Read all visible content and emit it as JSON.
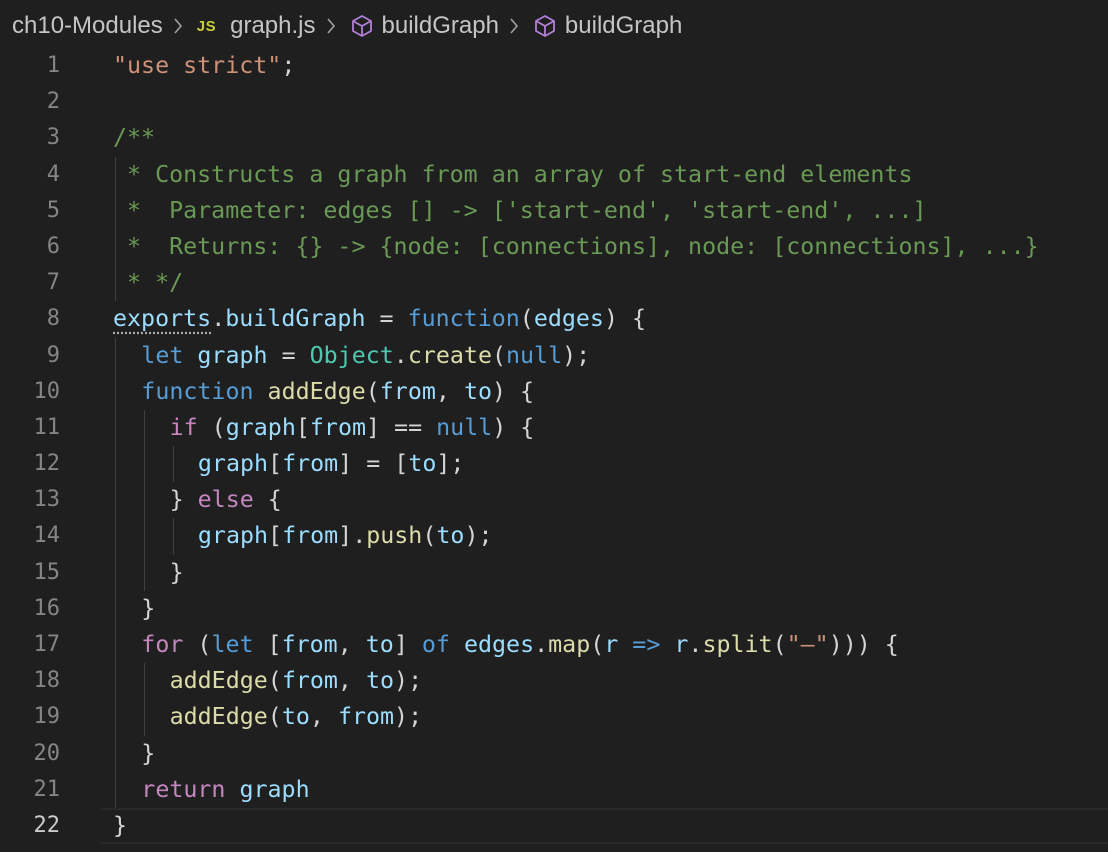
{
  "breadcrumb": {
    "folder": "ch10-Modules",
    "file_icon": "JS",
    "file": "graph.js",
    "symbol1": "buildGraph",
    "symbol2": "buildGraph"
  },
  "editor": {
    "active_line": 22,
    "lines": [
      {
        "n": "1",
        "indent": 0,
        "tokens": [
          {
            "t": "\"use strict\"",
            "c": "t-str"
          },
          {
            "t": ";",
            "c": "t-pun"
          }
        ]
      },
      {
        "n": "2",
        "indent": 0,
        "tokens": []
      },
      {
        "n": "3",
        "indent": 0,
        "tokens": [
          {
            "t": "/**",
            "c": "t-cmt"
          }
        ]
      },
      {
        "n": "4",
        "indent": 0,
        "tokens": [
          {
            "t": " * Constructs a graph from an array of start-end elements",
            "c": "t-cmt"
          }
        ]
      },
      {
        "n": "5",
        "indent": 0,
        "tokens": [
          {
            "t": " *  Parameter: edges [] -> ['start-end', 'start-end', ...]",
            "c": "t-cmt"
          }
        ]
      },
      {
        "n": "6",
        "indent": 0,
        "tokens": [
          {
            "t": " *  Returns: {} -> {node: [connections], node: [connections], ...}",
            "c": "t-cmt"
          }
        ]
      },
      {
        "n": "7",
        "indent": 0,
        "tokens": [
          {
            "t": " * */",
            "c": "t-cmt"
          }
        ]
      },
      {
        "n": "8",
        "indent": 0,
        "tokens": [
          {
            "t": "exports",
            "c": "t-var dotted"
          },
          {
            "t": ".",
            "c": "t-pun"
          },
          {
            "t": "buildGraph",
            "c": "t-var"
          },
          {
            "t": " = ",
            "c": "t-pun"
          },
          {
            "t": "function",
            "c": "t-kw"
          },
          {
            "t": "(",
            "c": "t-pun"
          },
          {
            "t": "edges",
            "c": "t-var"
          },
          {
            "t": ") {",
            "c": "t-pun"
          }
        ]
      },
      {
        "n": "9",
        "indent": 1,
        "tokens": [
          {
            "t": "let",
            "c": "t-kw"
          },
          {
            "t": " ",
            "c": "t-pun"
          },
          {
            "t": "graph",
            "c": "t-var"
          },
          {
            "t": " = ",
            "c": "t-pun"
          },
          {
            "t": "Object",
            "c": "t-cls"
          },
          {
            "t": ".",
            "c": "t-pun"
          },
          {
            "t": "create",
            "c": "t-fn"
          },
          {
            "t": "(",
            "c": "t-pun"
          },
          {
            "t": "null",
            "c": "t-kw"
          },
          {
            "t": ");",
            "c": "t-pun"
          }
        ]
      },
      {
        "n": "10",
        "indent": 1,
        "tokens": [
          {
            "t": "function",
            "c": "t-kw"
          },
          {
            "t": " ",
            "c": "t-pun"
          },
          {
            "t": "addEdge",
            "c": "t-fn"
          },
          {
            "t": "(",
            "c": "t-pun"
          },
          {
            "t": "from",
            "c": "t-var"
          },
          {
            "t": ", ",
            "c": "t-pun"
          },
          {
            "t": "to",
            "c": "t-var"
          },
          {
            "t": ") {",
            "c": "t-pun"
          }
        ]
      },
      {
        "n": "11",
        "indent": 2,
        "tokens": [
          {
            "t": "if",
            "c": "t-ctl"
          },
          {
            "t": " (",
            "c": "t-pun"
          },
          {
            "t": "graph",
            "c": "t-var"
          },
          {
            "t": "[",
            "c": "t-pun"
          },
          {
            "t": "from",
            "c": "t-var"
          },
          {
            "t": "] == ",
            "c": "t-pun"
          },
          {
            "t": "null",
            "c": "t-kw"
          },
          {
            "t": ") {",
            "c": "t-pun"
          }
        ]
      },
      {
        "n": "12",
        "indent": 3,
        "tokens": [
          {
            "t": "graph",
            "c": "t-var"
          },
          {
            "t": "[",
            "c": "t-pun"
          },
          {
            "t": "from",
            "c": "t-var"
          },
          {
            "t": "] = [",
            "c": "t-pun"
          },
          {
            "t": "to",
            "c": "t-var"
          },
          {
            "t": "];",
            "c": "t-pun"
          }
        ]
      },
      {
        "n": "13",
        "indent": 2,
        "tokens": [
          {
            "t": "} ",
            "c": "t-pun"
          },
          {
            "t": "else",
            "c": "t-ctl"
          },
          {
            "t": " {",
            "c": "t-pun"
          }
        ]
      },
      {
        "n": "14",
        "indent": 3,
        "tokens": [
          {
            "t": "graph",
            "c": "t-var"
          },
          {
            "t": "[",
            "c": "t-pun"
          },
          {
            "t": "from",
            "c": "t-var"
          },
          {
            "t": "].",
            "c": "t-pun"
          },
          {
            "t": "push",
            "c": "t-fn"
          },
          {
            "t": "(",
            "c": "t-pun"
          },
          {
            "t": "to",
            "c": "t-var"
          },
          {
            "t": ");",
            "c": "t-pun"
          }
        ]
      },
      {
        "n": "15",
        "indent": 2,
        "tokens": [
          {
            "t": "}",
            "c": "t-pun"
          }
        ]
      },
      {
        "n": "16",
        "indent": 1,
        "tokens": [
          {
            "t": "}",
            "c": "t-pun"
          }
        ]
      },
      {
        "n": "17",
        "indent": 1,
        "tokens": [
          {
            "t": "for",
            "c": "t-ctl"
          },
          {
            "t": " (",
            "c": "t-pun"
          },
          {
            "t": "let",
            "c": "t-kw"
          },
          {
            "t": " [",
            "c": "t-pun"
          },
          {
            "t": "from",
            "c": "t-var"
          },
          {
            "t": ", ",
            "c": "t-pun"
          },
          {
            "t": "to",
            "c": "t-var"
          },
          {
            "t": "] ",
            "c": "t-pun"
          },
          {
            "t": "of",
            "c": "t-kw"
          },
          {
            "t": " ",
            "c": "t-pun"
          },
          {
            "t": "edges",
            "c": "t-var"
          },
          {
            "t": ".",
            "c": "t-pun"
          },
          {
            "t": "map",
            "c": "t-fn"
          },
          {
            "t": "(",
            "c": "t-pun"
          },
          {
            "t": "r",
            "c": "t-var"
          },
          {
            "t": " => ",
            "c": "t-kw"
          },
          {
            "t": "r",
            "c": "t-var"
          },
          {
            "t": ".",
            "c": "t-pun"
          },
          {
            "t": "split",
            "c": "t-fn"
          },
          {
            "t": "(",
            "c": "t-pun"
          },
          {
            "t": "\"—\"",
            "c": "t-str"
          },
          {
            "t": "))) {",
            "c": "t-pun"
          }
        ]
      },
      {
        "n": "18",
        "indent": 2,
        "tokens": [
          {
            "t": "addEdge",
            "c": "t-fn"
          },
          {
            "t": "(",
            "c": "t-pun"
          },
          {
            "t": "from",
            "c": "t-var"
          },
          {
            "t": ", ",
            "c": "t-pun"
          },
          {
            "t": "to",
            "c": "t-var"
          },
          {
            "t": ");",
            "c": "t-pun"
          }
        ]
      },
      {
        "n": "19",
        "indent": 2,
        "tokens": [
          {
            "t": "addEdge",
            "c": "t-fn"
          },
          {
            "t": "(",
            "c": "t-pun"
          },
          {
            "t": "to",
            "c": "t-var"
          },
          {
            "t": ", ",
            "c": "t-pun"
          },
          {
            "t": "from",
            "c": "t-var"
          },
          {
            "t": ");",
            "c": "t-pun"
          }
        ]
      },
      {
        "n": "20",
        "indent": 1,
        "tokens": [
          {
            "t": "}",
            "c": "t-pun"
          }
        ]
      },
      {
        "n": "21",
        "indent": 1,
        "tokens": [
          {
            "t": "return",
            "c": "t-ctl"
          },
          {
            "t": " ",
            "c": "t-pun"
          },
          {
            "t": "graph",
            "c": "t-var"
          }
        ]
      },
      {
        "n": "22",
        "indent": 0,
        "tokens": [
          {
            "t": "}",
            "c": "t-pun"
          }
        ]
      }
    ]
  }
}
